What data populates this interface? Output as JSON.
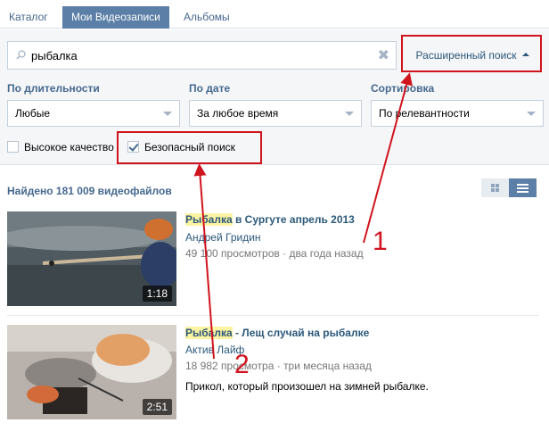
{
  "tabs": [
    {
      "label": "Каталог"
    },
    {
      "label": "Мои Видеозаписи"
    },
    {
      "label": "Альбомы"
    }
  ],
  "search": {
    "value": "рыбалка"
  },
  "advanced_search": {
    "label": "Расширенный поиск"
  },
  "filters": {
    "duration": {
      "label": "По длительности",
      "selected": "Любые"
    },
    "date": {
      "label": "По дате",
      "selected": "За любое время"
    },
    "sort": {
      "label": "Сортировка",
      "selected": "По релевантности"
    }
  },
  "checkboxes": {
    "hd": {
      "label": "Высокое качество",
      "checked": false
    },
    "safe": {
      "label": "Безопасный поиск",
      "checked": true
    }
  },
  "results": {
    "count_text": "Найдено 181 009 видеофайлов",
    "items": [
      {
        "title_highlight": "Рыбалка",
        "title_rest": " в Сургуте апрель 2013",
        "author": "Андрей Гридин",
        "views": "49 100 просмотров",
        "date": "два года назад",
        "duration": "1:18",
        "description": ""
      },
      {
        "title_highlight": "Рыбалка",
        "title_rest": " - Лещ случай на рыбалке",
        "author": "Актив Лайф",
        "views": "18 982 просмотра",
        "date": "три месяца назад",
        "duration": "2:51",
        "description": "Прикол, который произошел на зимней рыбалке."
      }
    ]
  },
  "annotations": {
    "one": "1",
    "two": "2"
  },
  "colors": {
    "annotation": "#d0141e",
    "link": "#2b587a",
    "active_tab": "#5b7fa6",
    "highlight": "#fcf4a3"
  }
}
